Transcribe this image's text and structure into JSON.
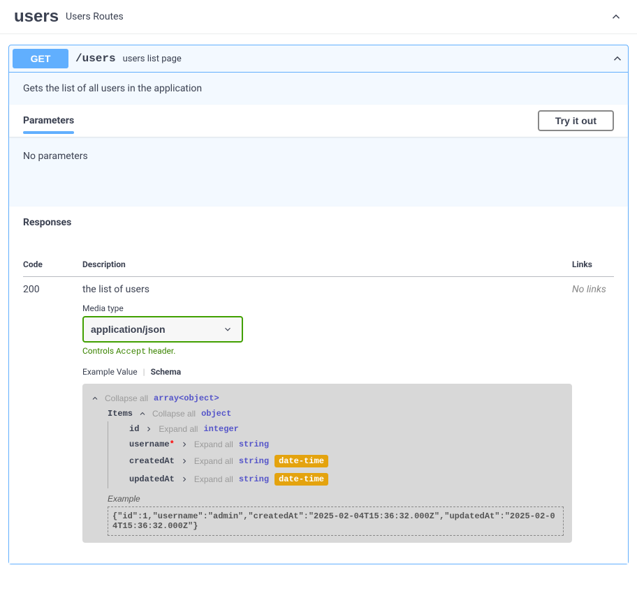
{
  "tag": {
    "name": "users",
    "description": "Users Routes"
  },
  "operation": {
    "method": "GET",
    "path": "/users",
    "summary": "users list page",
    "description": "Gets the list of all users in the application"
  },
  "parameters": {
    "title": "Parameters",
    "try_label": "Try it out",
    "empty": "No parameters"
  },
  "responses": {
    "title": "Responses",
    "headers": {
      "code": "Code",
      "description": "Description",
      "links": "Links"
    },
    "rows": [
      {
        "code": "200",
        "description": "the list of users",
        "links": "No links",
        "media": {
          "label": "Media type",
          "value": "application/json",
          "help_prefix": "Controls ",
          "help_code": "Accept",
          "help_suffix": " header."
        },
        "tabs": {
          "example": "Example Value",
          "schema": "Schema"
        },
        "schema": {
          "collapse_all": "Collapse all",
          "expand_all": "Expand all",
          "root_type": "array<object>",
          "items_label": "Items",
          "items_type": "object",
          "fields": [
            {
              "name": "id",
              "required": false,
              "hint": "Expand all",
              "type": "integer",
              "format": null
            },
            {
              "name": "username",
              "required": true,
              "hint": "Expand all",
              "type": "string",
              "format": null
            },
            {
              "name": "createdAt",
              "required": false,
              "hint": "Expand all",
              "type": "string",
              "format": "date-time"
            },
            {
              "name": "updatedAt",
              "required": false,
              "hint": "Expand all",
              "type": "string",
              "format": "date-time"
            }
          ],
          "example_label": "Example",
          "example_value": "{\"id\":1,\"username\":\"admin\",\"createdAt\":\"2025-02-04T15:36:32.000Z\",\"updatedAt\":\"2025-02-04T15:36:32.000Z\"}"
        }
      }
    ]
  }
}
